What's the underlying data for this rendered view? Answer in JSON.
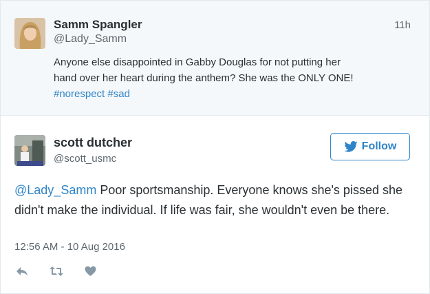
{
  "parent_tweet": {
    "name": "Samm Spangler",
    "handle": "@Lady_Samm",
    "time": "11h",
    "text_line1": "Anyone else disappointed in Gabby Douglas for not putting her",
    "text_line2": "hand over her heart during the anthem? She was the ONLY ONE!",
    "hashtag1": "#norespect",
    "hashtag2": "#sad"
  },
  "reply_tweet": {
    "name": "scott dutcher",
    "handle": "@scott_usmc",
    "follow_label": "Follow",
    "mention": "@Lady_Samm",
    "text": " Poor sportsmanship. Everyone knows she's pissed she didn't make the individual. If life was fair, she wouldn't even be there.",
    "timestamp": "12:56 AM - 10 Aug 2016"
  },
  "colors": {
    "link": "#2f84c7",
    "text": "#292f33",
    "muted": "#5d676f",
    "parent_bg": "#f5f8fa"
  },
  "icons": [
    "reply-icon",
    "retweet-icon",
    "like-icon",
    "twitter-bird-icon"
  ]
}
